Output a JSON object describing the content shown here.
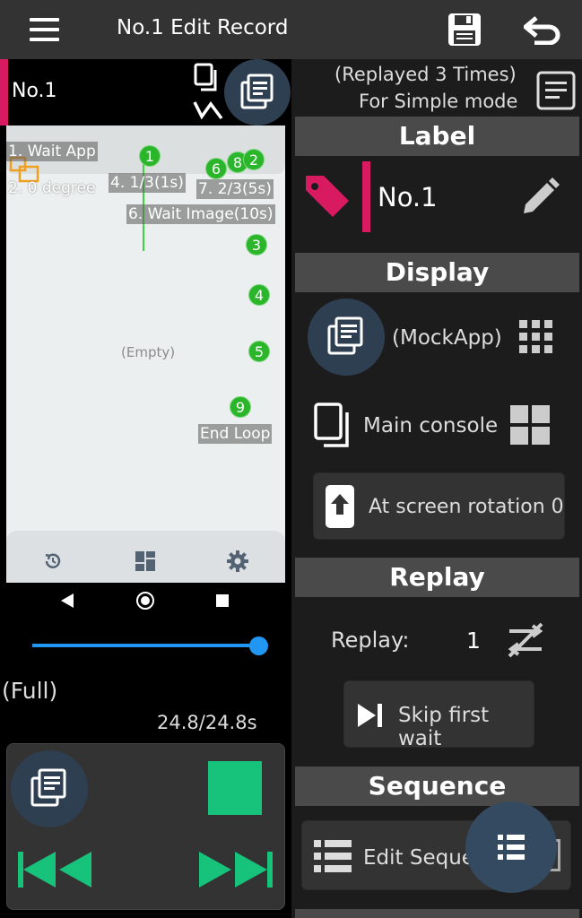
{
  "header": {
    "title": "No.1 Edit Record"
  },
  "left": {
    "record_name": "No.1",
    "preview": {
      "empty_label": "(Empty)",
      "labels": [
        "1. Wait App",
        "2. 0 degree",
        "4. 1/3(1s)",
        "7. 2/3(5s)",
        "6. Wait Image(10s)",
        "End Loop"
      ],
      "dots": [
        "1",
        "6",
        "8",
        "2",
        "3",
        "4",
        "5",
        "9"
      ]
    },
    "mode_label": "(Full)",
    "time_readout": "24.8/24.8s",
    "progress": 1.0
  },
  "right": {
    "replay_info_line1": "(Replayed 3 Times)",
    "replay_info_line2": "For Simple mode",
    "label_section": {
      "heading": "Label",
      "name": "No.1"
    },
    "display_section": {
      "heading": "Display",
      "app_label": "(MockApp)",
      "console_label": "Main console",
      "rotation_button": "At screen rotation 0"
    },
    "replay_section": {
      "heading": "Replay",
      "replay_label": "Replay:",
      "replay_count": "1",
      "skip_button": "Skip first wait"
    },
    "sequence_section": {
      "heading": "Sequence",
      "edit_button": "Edit Seque"
    }
  },
  "colors": {
    "accent_pink": "#d81b60",
    "green": "#17c27a",
    "circle_button": "#2e3f52",
    "slider": "#2196f3"
  }
}
